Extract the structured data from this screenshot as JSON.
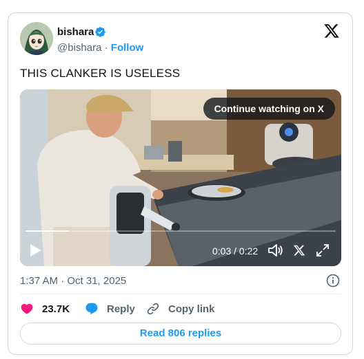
{
  "author": {
    "display_name": "bishara",
    "handle": "@bishara",
    "separator": "·",
    "follow_label": "Follow"
  },
  "tweet": {
    "text": "THIS CLANKER IS USELESS",
    "timestamp": "1:37 AM · Oct 31, 2025"
  },
  "video": {
    "continue_label": "Continue watching on X",
    "time": "0:03 / 0:22",
    "progress_fraction": 0.14
  },
  "actions": {
    "likes": "23.7K",
    "reply_label": "Reply",
    "copy_link_label": "Copy link"
  },
  "read_replies_label": "Read 806 replies",
  "colors": {
    "accent": "#1d9bf0",
    "like": "#f91880",
    "text_primary": "#0f1419",
    "text_secondary": "#536471",
    "border": "#cfd9de"
  },
  "icons": [
    "verified-badge-icon",
    "x-logo-icon",
    "play-icon",
    "volume-icon",
    "x-icon",
    "fullscreen-icon",
    "info-icon",
    "heart-icon",
    "reply-bubble-icon",
    "link-icon"
  ]
}
